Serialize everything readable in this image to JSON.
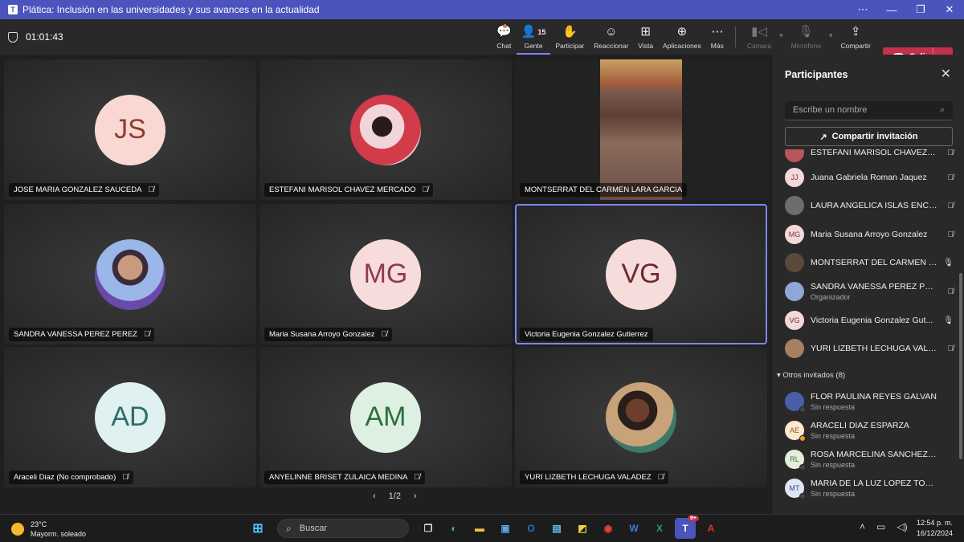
{
  "window": {
    "title": "Plática: Inclusión en las universidades y sus avances en la actualidad"
  },
  "meeting": {
    "timer": "01:01:43"
  },
  "toolbar": {
    "chat": "Chat",
    "people": "Gente",
    "people_count": "15",
    "raise": "Participar",
    "react": "Reaccionar",
    "view": "Vista",
    "apps": "Aplicaciones",
    "more": "Más",
    "camera": "Cámara",
    "mic": "Micrófono",
    "share": "Compartir",
    "leave": "Salir"
  },
  "tiles": [
    {
      "name": "JOSE MARIA GONZALEZ SAUCEDA",
      "initials": "JS",
      "color": "#f9d8d4",
      "text": "#8f3b30"
    },
    {
      "name": "ESTEFANI MARISOL CHAVEZ MERCADO",
      "initials": "",
      "color": "#c94a55",
      "text": "#fff"
    },
    {
      "name": "MONTSERRAT DEL CARMEN LARA GARCIA",
      "initials": "",
      "color": "",
      "text": ""
    },
    {
      "name": "SANDRA VANESSA PEREZ PEREZ",
      "initials": "",
      "color": "#8fa7d8",
      "text": "#fff"
    },
    {
      "name": "Maria Susana Arroyo Gonzalez",
      "initials": "MG",
      "color": "#f7dcdc",
      "text": "#8d3b4a"
    },
    {
      "name": "Victoria Eugenia Gonzalez Gutierrez",
      "initials": "VG",
      "color": "#f7dcdc",
      "text": "#6e2a33"
    },
    {
      "name": "Araceli Diaz (No comprobado)",
      "initials": "AD",
      "color": "#dff1f0",
      "text": "#2b6e6b"
    },
    {
      "name": "ANYELINNE BRISET ZULAICA MEDINA",
      "initials": "AM",
      "color": "#def0e2",
      "text": "#2e6d3d"
    },
    {
      "name": "YURI LIZBETH LECHUGA VALADEZ",
      "initials": "",
      "color": "#b07a58",
      "text": "#fff"
    }
  ],
  "pager": {
    "label": "1/2"
  },
  "panel": {
    "title": "Participantes",
    "search_placeholder": "Escribe un nombre",
    "share_invite": "Compartir invitación",
    "participants": [
      {
        "name": "ESTEFANI MARISOL CHAVEZ M...",
        "initials": "",
        "sub": "",
        "mic": "off"
      },
      {
        "name": "Juana Gabriela Roman Jaquez",
        "initials": "JJ",
        "sub": "",
        "mic": "off"
      },
      {
        "name": "LAURA ANGELICA ISLAS ENCI...",
        "initials": "",
        "sub": "",
        "mic": "off"
      },
      {
        "name": "Maria Susana Arroyo Gonzalez",
        "initials": "MG",
        "sub": "",
        "mic": "off"
      },
      {
        "name": "MONTSERRAT DEL CARMEN L...",
        "initials": "",
        "sub": "",
        "mic": "on"
      },
      {
        "name": "SANDRA VANESSA PEREZ PER...",
        "initials": "",
        "sub": "Organizador",
        "mic": "off"
      },
      {
        "name": "Victoria Eugenia Gonzalez Gut...",
        "initials": "VG",
        "sub": "",
        "mic": "on"
      },
      {
        "name": "YURI LIZBETH LECHUGA VALA...",
        "initials": "",
        "sub": "",
        "mic": "off"
      }
    ],
    "others_label": "Otros invitados (8)",
    "others": [
      {
        "name": "FLOR PAULINA REYES GALVAN",
        "initials": "",
        "sub": "Sin respuesta"
      },
      {
        "name": "ARACELI DIAZ ESPARZA",
        "initials": "AE",
        "sub": "Sin respuesta"
      },
      {
        "name": "ROSA MARCELINA SANCHEZ LOM...",
        "initials": "RL",
        "sub": "Sin respuesta"
      },
      {
        "name": "MARIA DE LA LUZ LOPEZ TOVAR",
        "initials": "MT",
        "sub": "Sin respuesta"
      }
    ]
  },
  "taskbar": {
    "temp": "23°C",
    "weather": "Mayorm. soleado",
    "search": "Buscar",
    "teams_badge": "9+",
    "time": "12:54 p. m.",
    "date": "16/12/2024"
  }
}
